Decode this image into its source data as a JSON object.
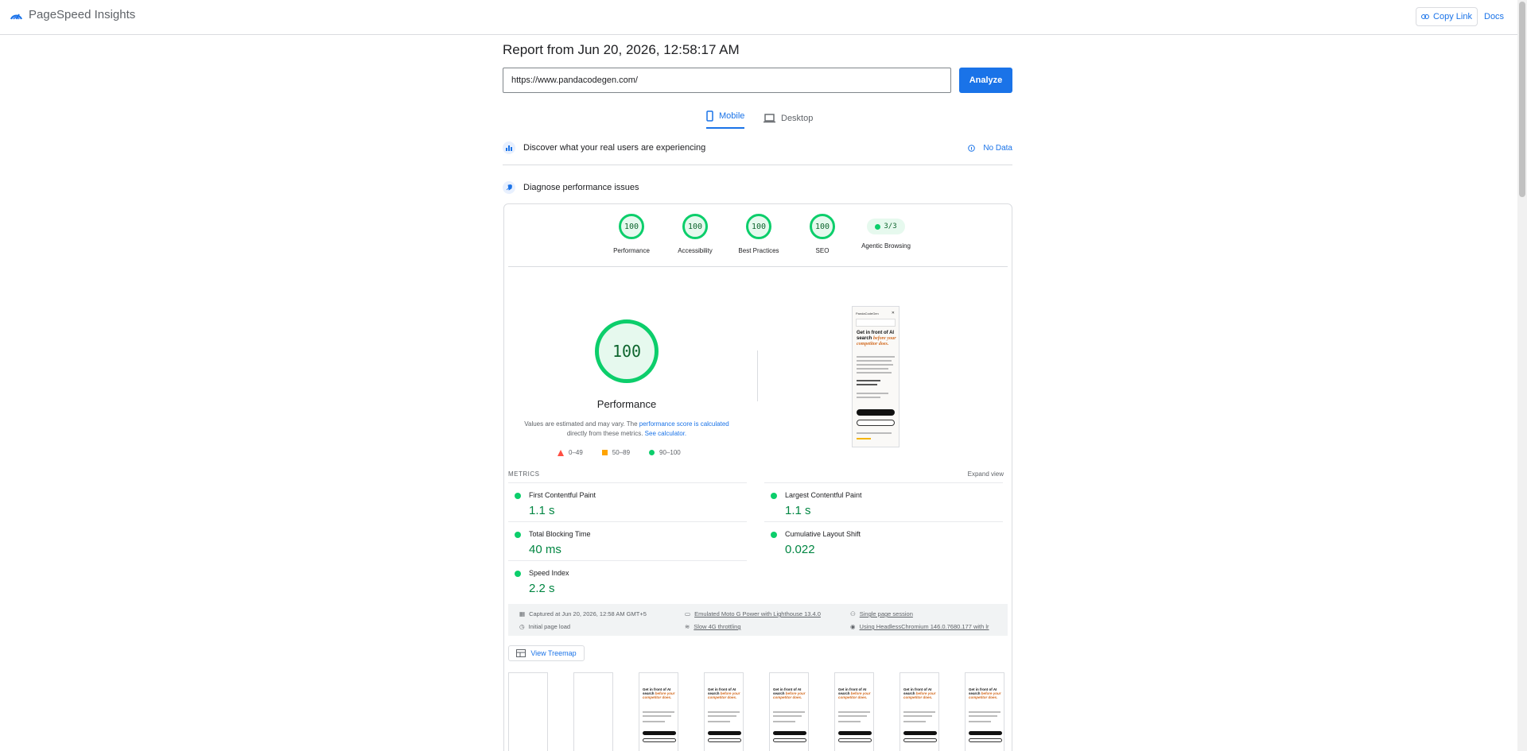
{
  "header": {
    "brand": "PageSpeed Insights",
    "copy_link": "Copy Link",
    "docs": "Docs"
  },
  "report": {
    "title": "Report from Jun 20, 2026, 12:58:17 AM",
    "url": "https://www.pandacodegen.com/",
    "analyze": "Analyze",
    "tabs": {
      "mobile": "Mobile",
      "desktop": "Desktop"
    }
  },
  "field": {
    "label": "Discover what your real users are experiencing",
    "no_data": "No Data"
  },
  "diagnose": {
    "label": "Diagnose performance issues"
  },
  "scores": [
    {
      "label": "Performance",
      "value": "100"
    },
    {
      "label": "Accessibility",
      "value": "100"
    },
    {
      "label": "Best Practices",
      "value": "100"
    },
    {
      "label": "SEO",
      "value": "100"
    }
  ],
  "agentic": {
    "label": "Agentic Browsing",
    "value": "3/3"
  },
  "performance": {
    "score": "100",
    "label": "Performance",
    "note_1": "Values are estimated and may vary. The ",
    "note_link_1": "performance score is calculated",
    "note_2": " directly from these metrics. ",
    "note_link_2": "See calculator.",
    "legend": {
      "fail": "0–49",
      "average": "50–89",
      "pass": "90–100"
    }
  },
  "screenshot": {
    "brand": "PandaCodeGen",
    "headline": "Get in front of AI search",
    "headline_accent": "before your competitor does."
  },
  "metrics": {
    "title": "METRICS",
    "expand": "Expand view",
    "items": [
      {
        "name": "First Contentful Paint",
        "value": "1.1 s"
      },
      {
        "name": "Largest Contentful Paint",
        "value": "1.1 s"
      },
      {
        "name": "Total Blocking Time",
        "value": "40 ms"
      },
      {
        "name": "Cumulative Layout Shift",
        "value": "0.022"
      },
      {
        "name": "Speed Index",
        "value": "2.2 s"
      }
    ]
  },
  "run_info": {
    "captured": "Captured at Jun 20, 2026, 12:58 AM GMT+5",
    "device": "Emulated Moto G Power with Lighthouse 13.4.0",
    "session": "Single page session",
    "load": "Initial page load",
    "throttling": "Slow 4G throttling",
    "browser": "Using HeadlessChromium 146.0.7680.177 with lr"
  },
  "treemap": "View Treemap",
  "colors": {
    "pass": "#0cce6b",
    "accent": "#1a73e8",
    "metric_value": "#018642"
  }
}
